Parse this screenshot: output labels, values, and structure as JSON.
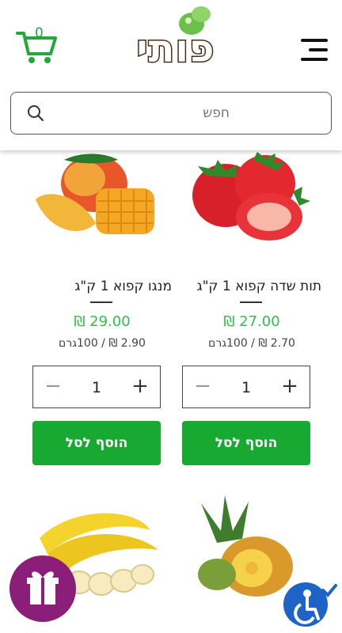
{
  "header": {
    "cart_count": "0",
    "logo_text": "פותי",
    "search": {
      "placeholder": "חפש"
    }
  },
  "products": [
    {
      "title": "תות שדה קפוא 1 ק\"ג",
      "price": "₪ 27.00",
      "unit_price": "2.70 ₪ / 100גרם",
      "quantity": "1",
      "add_label": "הוסף לסל",
      "image": "strawberry-image"
    },
    {
      "title": "מנגו קפוא 1 ק\"ג",
      "price": "₪ 29.00",
      "unit_price": "2.90 ₪ / 100גרם",
      "quantity": "1",
      "add_label": "הוסף לסל",
      "image": "mango-image"
    },
    {
      "image": "pineapple-image"
    },
    {
      "image": "banana-image"
    }
  ],
  "colors": {
    "accent_green": "#18a933",
    "price_green": "#2fbf4a",
    "gift_purple": "#8b1e78",
    "access_blue": "#1d64c6"
  },
  "icons": [
    "cart-icon",
    "menu-icon",
    "search-icon",
    "minus-icon",
    "plus-icon",
    "gift-icon",
    "accessibility-icon"
  ]
}
